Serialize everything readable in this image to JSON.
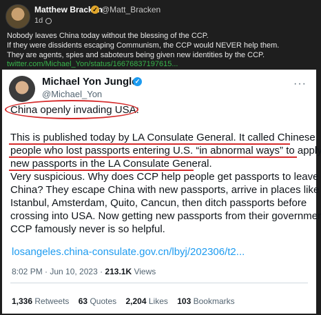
{
  "post": {
    "author_name": "Matthew Bracken",
    "author_handle": "@Matt_Bracken",
    "time": "1d",
    "text_lines": [
      "Nobody leaves China today without the blessing of the CCP.",
      "If they were dissidents escaping Communism, the CCP would NEVER help them.",
      "They are agents, spies and saboteurs being given new identities by the CCP."
    ],
    "link": "twitter.com/Michael_Yon/status/16676837197615..."
  },
  "tweet": {
    "name": "Michael Yon Jungle",
    "handle": "@Michael_Yon",
    "headline": "China openly invading USA:",
    "body_lines": [
      "This is published today by LA Consulate General. It called Chinese",
      "people who lost passports entering U.S. “in abnormal ways” to apply for",
      "new passports in the LA Consulate General.",
      "Very suspicious. Why does CCP help people get passports to leave",
      "China?  They escape China with new passports, arrive in places like",
      "Istanbul, Amsterdam, Quito, Cancun, then ditch passports before",
      "crossing into USA.  Now getting new passports from their government.",
      "CCP famously never is so helpful."
    ],
    "link": "losangeles.china-consulate.gov.cn/lbyj/202306/t2...",
    "timestamp": "8:02 PM · Jun 10, 2023 ·",
    "views_count": "213.1K",
    "views_label": "Views",
    "stats": [
      {
        "count": "1,336",
        "label": "Retweets"
      },
      {
        "count": "63",
        "label": "Quotes"
      },
      {
        "count": "2,204",
        "label": "Likes"
      },
      {
        "count": "103",
        "label": "Bookmarks"
      }
    ]
  },
  "colors": {
    "annotation_red": "#d52b2b",
    "post_link_green": "#37b34a",
    "twitter_blue": "#1d9bf0"
  }
}
